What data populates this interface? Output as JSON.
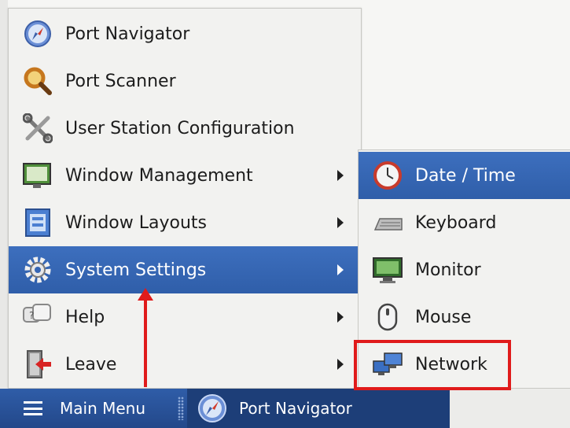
{
  "main_menu": {
    "items": [
      {
        "label": "Port Navigator",
        "icon": "compass-icon",
        "has_submenu": false
      },
      {
        "label": "Port Scanner",
        "icon": "magnifier-icon",
        "has_submenu": false
      },
      {
        "label": "User Station Configuration",
        "icon": "tools-icon",
        "has_submenu": false
      },
      {
        "label": "Window Management",
        "icon": "window-icon",
        "has_submenu": true
      },
      {
        "label": "Window Layouts",
        "icon": "layouts-icon",
        "has_submenu": true
      },
      {
        "label": "System Settings",
        "icon": "gear-icon",
        "has_submenu": true,
        "active": true
      },
      {
        "label": "Help",
        "icon": "help-icon",
        "has_submenu": true
      },
      {
        "label": "Leave",
        "icon": "leave-icon",
        "has_submenu": true
      }
    ]
  },
  "sub_menu": {
    "items": [
      {
        "label": "Date / Time",
        "icon": "clock-icon",
        "active": true
      },
      {
        "label": "Keyboard",
        "icon": "keyboard-icon"
      },
      {
        "label": "Monitor",
        "icon": "monitor-icon"
      },
      {
        "label": "Mouse",
        "icon": "mouse-icon"
      },
      {
        "label": "Network",
        "icon": "network-icon"
      }
    ]
  },
  "taskbar": {
    "start_label": "Main Menu",
    "task_label": "Port Navigator"
  },
  "colors": {
    "highlight": "#3566b4",
    "annotation": "#e01b1b",
    "taskbar": "#2a519a"
  }
}
